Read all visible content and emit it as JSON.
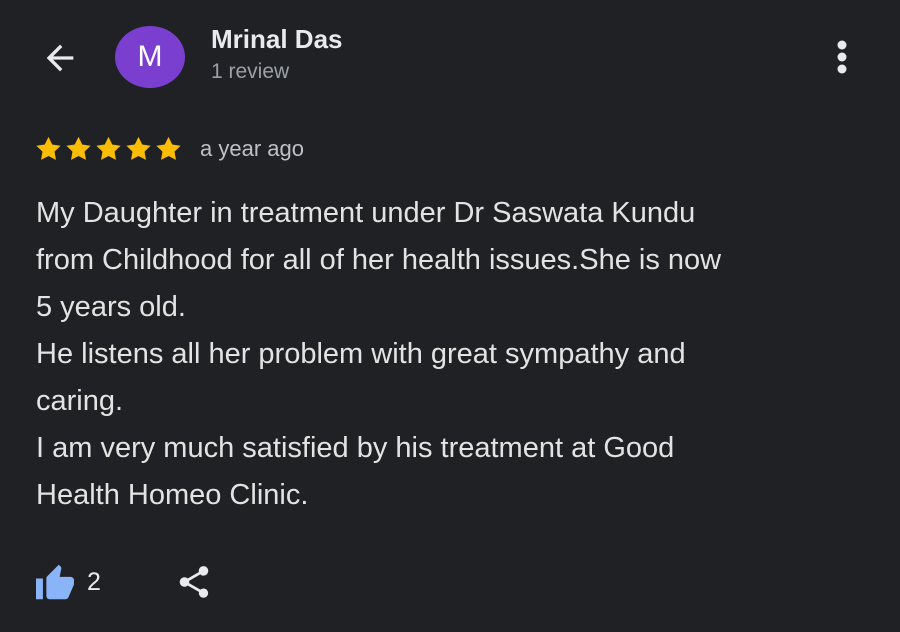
{
  "header": {
    "back_icon": "arrow-left-icon",
    "avatar_letter": "M",
    "avatar_color": "#7b3fd0",
    "author_name": "Mrinal Das",
    "author_meta": "1 review",
    "more_icon": "more-vertical-icon"
  },
  "review": {
    "rating": 5,
    "rating_max": 5,
    "star_color": "#fbbc04",
    "time": "a year ago",
    "lines": [
      "My Daughter in treatment under Dr Saswata Kundu",
      "from Childhood for all of her health issues.She is now",
      "5 years old.",
      "He listens all her problem with great sympathy and",
      "caring.",
      "I am very much satisfied by his treatment at Good",
      "Health Homeo Clinic."
    ]
  },
  "actions": {
    "like_icon": "thumbs-up-icon",
    "like_color": "#8ab4f8",
    "like_count": "2",
    "share_icon": "share-icon"
  }
}
